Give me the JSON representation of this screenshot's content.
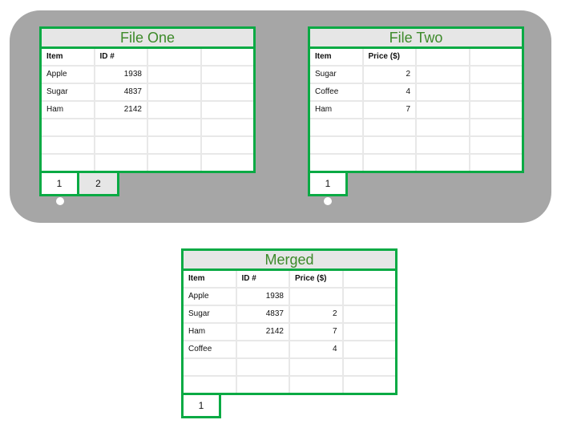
{
  "colors": {
    "border_green": "#0aaa44",
    "title_text": "#3d8a2a",
    "panel_gray": "#a6a6a6"
  },
  "file_one": {
    "title": "File One",
    "columns": [
      "Item",
      "ID #",
      "",
      ""
    ],
    "rows": [
      [
        "Apple",
        "1938",
        "",
        ""
      ],
      [
        "Sugar",
        "4837",
        "",
        ""
      ],
      [
        "Ham",
        "2142",
        "",
        ""
      ],
      [
        "",
        "",
        "",
        ""
      ],
      [
        "",
        "",
        "",
        ""
      ],
      [
        "",
        "",
        "",
        ""
      ]
    ],
    "tabs": [
      {
        "label": "1",
        "active": true
      },
      {
        "label": "2",
        "active": false
      }
    ]
  },
  "file_two": {
    "title": "File Two",
    "columns": [
      "Item",
      "Price ($)",
      "",
      ""
    ],
    "rows": [
      [
        "Sugar",
        "2",
        "",
        ""
      ],
      [
        "Coffee",
        "4",
        "",
        ""
      ],
      [
        "Ham",
        "7",
        "",
        ""
      ],
      [
        "",
        "",
        "",
        ""
      ],
      [
        "",
        "",
        "",
        ""
      ],
      [
        "",
        "",
        "",
        ""
      ]
    ],
    "tabs": [
      {
        "label": "1",
        "active": true
      }
    ]
  },
  "merged": {
    "title": "Merged",
    "columns": [
      "Item",
      "ID #",
      "Price ($)",
      ""
    ],
    "rows": [
      [
        "Apple",
        "1938",
        "",
        ""
      ],
      [
        "Sugar",
        "4837",
        "2",
        ""
      ],
      [
        "Ham",
        "2142",
        "7",
        ""
      ],
      [
        "Coffee",
        "",
        "4",
        ""
      ],
      [
        "",
        "",
        "",
        ""
      ],
      [
        "",
        "",
        "",
        ""
      ]
    ],
    "tabs": [
      {
        "label": "1",
        "active": true
      }
    ]
  }
}
